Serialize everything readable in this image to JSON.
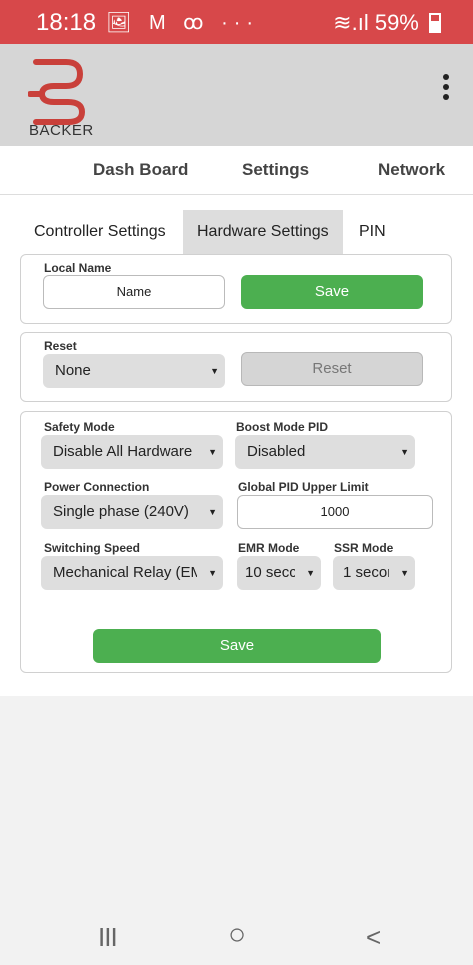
{
  "status_bar": {
    "time": "18:18",
    "left_icons": "🖼 M ꝏ ···",
    "signal": "≋.ıl",
    "battery": "59%"
  },
  "app_bar": {
    "brand": "BACKER",
    "menu_icon": "more-vert-icon"
  },
  "nav": {
    "tabs": [
      "Dash Board",
      "Settings",
      "Network"
    ]
  },
  "subtabs": {
    "items": [
      "Controller Settings",
      "Hardware Settings",
      "PIN"
    ],
    "active": "Hardware Settings"
  },
  "local_name": {
    "label": "Local Name",
    "placeholder": "Name",
    "save": "Save"
  },
  "reset": {
    "label": "Reset",
    "selected": "None",
    "button": "Reset"
  },
  "hardware": {
    "safety_mode": {
      "label": "Safety Mode",
      "selected": "Disable All Hardware ("
    },
    "boost_mode_pid": {
      "label": "Boost Mode PID",
      "selected": "Disabled"
    },
    "power_connection": {
      "label": "Power Connection",
      "selected": "Single phase (240V)"
    },
    "global_pid_upper_limit": {
      "label": "Global PID Upper Limit",
      "value": "1000"
    },
    "switching_speed": {
      "label": "Switching Speed",
      "selected": "Mechanical Relay (EM"
    },
    "emr_mode": {
      "label": "EMR Mode",
      "selected": "10 secc"
    },
    "ssr_mode": {
      "label": "SSR Mode",
      "selected": "1 secor"
    },
    "save": "Save"
  },
  "colors": {
    "status_bar": "#d7484a",
    "accent_green": "#4caf50",
    "logo": "#c9403a"
  },
  "android_nav": {
    "recents": "III",
    "home": "○",
    "back": "<"
  }
}
